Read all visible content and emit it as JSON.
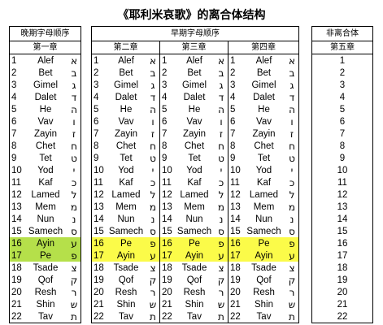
{
  "title": "《耶利米哀歌》的离合体结构",
  "late": {
    "header": "晚期字母顺序",
    "chapter": "第一章",
    "rows": [
      {
        "n": "1",
        "name": "Alef",
        "heb": "א",
        "hl": ""
      },
      {
        "n": "2",
        "name": "Bet",
        "heb": "ב",
        "hl": ""
      },
      {
        "n": "3",
        "name": "Gimel",
        "heb": "ג",
        "hl": ""
      },
      {
        "n": "4",
        "name": "Dalet",
        "heb": "ד",
        "hl": ""
      },
      {
        "n": "5",
        "name": "He",
        "heb": "ה",
        "hl": ""
      },
      {
        "n": "6",
        "name": "Vav",
        "heb": "ו",
        "hl": ""
      },
      {
        "n": "7",
        "name": "Zayin",
        "heb": "ז",
        "hl": ""
      },
      {
        "n": "8",
        "name": "Chet",
        "heb": "ח",
        "hl": ""
      },
      {
        "n": "9",
        "name": "Tet",
        "heb": "ט",
        "hl": ""
      },
      {
        "n": "10",
        "name": "Yod",
        "heb": "י",
        "hl": ""
      },
      {
        "n": "11",
        "name": "Kaf",
        "heb": "כ",
        "hl": ""
      },
      {
        "n": "12",
        "name": "Lamed",
        "heb": "ל",
        "hl": ""
      },
      {
        "n": "13",
        "name": "Mem",
        "heb": "מ",
        "hl": ""
      },
      {
        "n": "14",
        "name": "Nun",
        "heb": "נ",
        "hl": ""
      },
      {
        "n": "15",
        "name": "Samech",
        "heb": "ס",
        "hl": ""
      },
      {
        "n": "16",
        "name": "Ayin",
        "heb": "ע",
        "hl": "hlg"
      },
      {
        "n": "17",
        "name": "Pe",
        "heb": "פ",
        "hl": "hlg"
      },
      {
        "n": "18",
        "name": "Tsade",
        "heb": "צ",
        "hl": ""
      },
      {
        "n": "19",
        "name": "Qof",
        "heb": "ק",
        "hl": ""
      },
      {
        "n": "20",
        "name": "Resh",
        "heb": "ר",
        "hl": ""
      },
      {
        "n": "21",
        "name": "Shin",
        "heb": "ש",
        "hl": ""
      },
      {
        "n": "22",
        "name": "Tav",
        "heb": "ת",
        "hl": ""
      }
    ]
  },
  "early": {
    "header": "早期字母顺序",
    "chapters": [
      "第二章",
      "第三章",
      "第四章"
    ],
    "rows": [
      {
        "n": "1",
        "name": "Alef",
        "heb": "א",
        "hl": ""
      },
      {
        "n": "2",
        "name": "Bet",
        "heb": "ב",
        "hl": ""
      },
      {
        "n": "3",
        "name": "Gimel",
        "heb": "ג",
        "hl": ""
      },
      {
        "n": "4",
        "name": "Dalet",
        "heb": "ד",
        "hl": ""
      },
      {
        "n": "5",
        "name": "He",
        "heb": "ה",
        "hl": ""
      },
      {
        "n": "6",
        "name": "Vav",
        "heb": "ו",
        "hl": ""
      },
      {
        "n": "7",
        "name": "Zayin",
        "heb": "ז",
        "hl": ""
      },
      {
        "n": "8",
        "name": "Chet",
        "heb": "ח",
        "hl": ""
      },
      {
        "n": "9",
        "name": "Tet",
        "heb": "ט",
        "hl": ""
      },
      {
        "n": "10",
        "name": "Yod",
        "heb": "י",
        "hl": ""
      },
      {
        "n": "11",
        "name": "Kaf",
        "heb": "כ",
        "hl": ""
      },
      {
        "n": "12",
        "name": "Lamed",
        "heb": "ל",
        "hl": ""
      },
      {
        "n": "13",
        "name": "Mem",
        "heb": "מ",
        "hl": ""
      },
      {
        "n": "14",
        "name": "Nun",
        "heb": "נ",
        "hl": ""
      },
      {
        "n": "15",
        "name": "Samech",
        "heb": "ס",
        "hl": ""
      },
      {
        "n": "16",
        "name": "Pe",
        "heb": "פ",
        "hl": "hl"
      },
      {
        "n": "17",
        "name": "Ayin",
        "heb": "ע",
        "hl": "hl"
      },
      {
        "n": "18",
        "name": "Tsade",
        "heb": "צ",
        "hl": ""
      },
      {
        "n": "19",
        "name": "Qof",
        "heb": "ק",
        "hl": ""
      },
      {
        "n": "20",
        "name": "Resh",
        "heb": "ר",
        "hl": ""
      },
      {
        "n": "21",
        "name": "Shin",
        "heb": "ש",
        "hl": ""
      },
      {
        "n": "22",
        "name": "Tav",
        "heb": "ת",
        "hl": ""
      }
    ]
  },
  "nonacrostic": {
    "header": "非离合体",
    "chapter": "第五章",
    "numbers": [
      "1",
      "2",
      "3",
      "4",
      "5",
      "6",
      "7",
      "8",
      "9",
      "10",
      "11",
      "12",
      "13",
      "14",
      "15",
      "16",
      "17",
      "18",
      "19",
      "20",
      "21",
      "22"
    ]
  }
}
